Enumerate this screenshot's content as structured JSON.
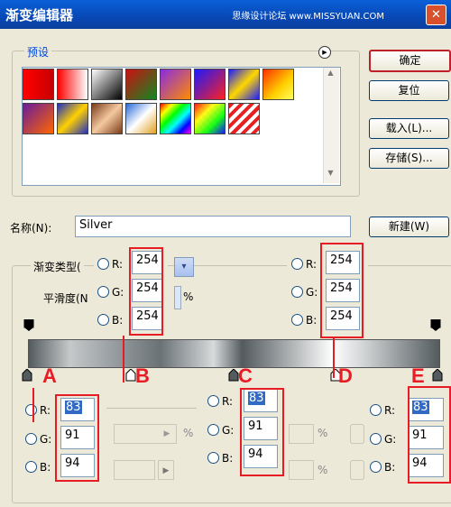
{
  "window": {
    "title": "渐变编辑器",
    "watermark": "思缘设计论坛 www.MISSYUAN.COM",
    "close_label": "✕"
  },
  "presets": {
    "label": "预设"
  },
  "buttons": {
    "ok": "确定",
    "reset": "复位",
    "load": "载入(L)...",
    "save": "存储(S)...",
    "new": "新建(W)"
  },
  "name_field": {
    "label": "名称(N):",
    "value": "Silver"
  },
  "gradient": {
    "type_label": "渐变类型(",
    "smooth_label": "平滑度(N",
    "percent": "%"
  },
  "rgb_top_left": {
    "r": "254",
    "g": "254",
    "b": "254"
  },
  "rgb_top_right": {
    "r": "254",
    "g": "254",
    "b": "254"
  },
  "rgb_a": {
    "r": "83",
    "g": "91",
    "b": "94"
  },
  "rgb_c": {
    "r": "83",
    "g": "91",
    "b": "94"
  },
  "rgb_e": {
    "r": "83",
    "g": "91",
    "b": "94"
  },
  "channel_labels": {
    "r": "R:",
    "g": "G:",
    "b": "B:"
  },
  "annotations": {
    "a": "A",
    "b": "B",
    "c": "C",
    "d": "D",
    "e": "E"
  }
}
